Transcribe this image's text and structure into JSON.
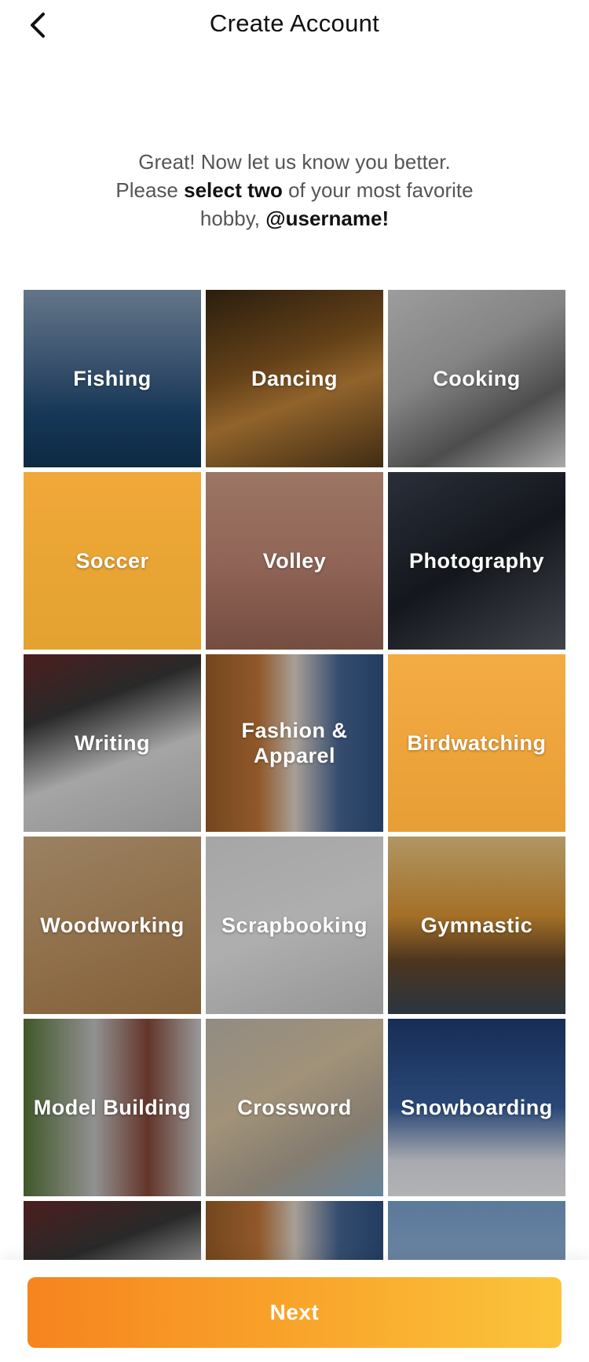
{
  "header": {
    "title": "Create Account",
    "back_icon": "chevron-left-icon"
  },
  "intro": {
    "line1": "Great! Now let us know you better.",
    "line2_pre": "Please ",
    "line2_bold": "select two",
    "line2_post": " of your most favorite",
    "line3_pre": "hobby, ",
    "line3_bold": "@username!"
  },
  "colors": {
    "selected_overlay": "#f7a632",
    "button_gradient_start": "#f6841f",
    "button_gradient_end": "#fbc43b"
  },
  "hobbies": [
    {
      "label": "Fishing",
      "selected": false
    },
    {
      "label": "Dancing",
      "selected": false
    },
    {
      "label": "Cooking",
      "selected": false
    },
    {
      "label": "Soccer",
      "selected": true
    },
    {
      "label": "Volley",
      "selected": false
    },
    {
      "label": "Photography",
      "selected": false
    },
    {
      "label": "Writing",
      "selected": false
    },
    {
      "label": "Fashion & Apparel",
      "selected": false
    },
    {
      "label": "Birdwatching",
      "selected": true
    },
    {
      "label": "Woodworking",
      "selected": false
    },
    {
      "label": "Scrapbooking",
      "selected": false
    },
    {
      "label": "Gymnastic",
      "selected": false
    },
    {
      "label": "Model Building",
      "selected": false
    },
    {
      "label": "Crossword",
      "selected": false
    },
    {
      "label": "Snowboarding",
      "selected": false
    },
    {
      "label": "",
      "selected": false
    },
    {
      "label": "",
      "selected": false
    },
    {
      "label": "",
      "selected": false
    }
  ],
  "footer": {
    "next_label": "Next"
  }
}
